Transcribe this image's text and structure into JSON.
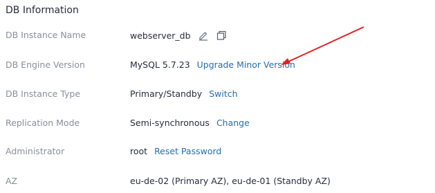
{
  "section": {
    "title": "DB Information"
  },
  "rows": [
    {
      "label": "DB Instance Name",
      "value": "webserver_db"
    },
    {
      "label": "DB Engine Version",
      "value": "MySQL 5.7.23",
      "link": "Upgrade Minor Version"
    },
    {
      "label": "DB Instance Type",
      "value": "Primary/Standby",
      "link": "Switch"
    },
    {
      "label": "Replication Mode",
      "value": "Semi-synchronous",
      "link": "Change"
    },
    {
      "label": "Administrator",
      "value": "root",
      "link": "Reset Password"
    },
    {
      "label": "AZ",
      "value": "eu-de-02 (Primary AZ), eu-de-01 (Standby AZ)"
    }
  ],
  "icons": {
    "edit": "pencil-icon",
    "copy": "copy-icon"
  },
  "colors": {
    "link": "#256daf",
    "label": "#8a8e99",
    "value": "#252b3a",
    "annotation_arrow": "#e02020"
  }
}
